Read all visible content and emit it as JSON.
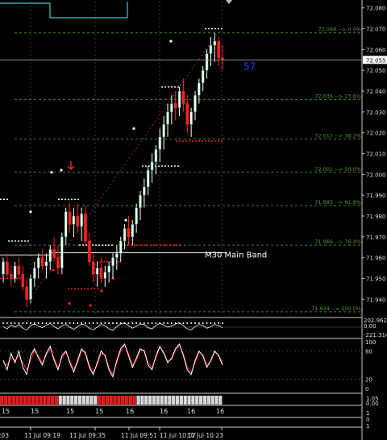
{
  "colors": {
    "background": "#000000",
    "grid": "#3a3a3a",
    "bull": "#ffffff",
    "bear": "#ff2020",
    "body_up": "#2e8b57",
    "fib": "#3f8a1f",
    "fib_text": "#4aa02c",
    "band": "#c8c8c8",
    "cyan_line": "#49c6cf",
    "price_label_bg": "#ffffff",
    "price_label_fg": "#000000",
    "counter": "#1a3cff",
    "stoch_white": "#ffffff",
    "stoch_red": "#ff2020",
    "axis_text": "#dddddd"
  },
  "window": {
    "top_marker_icon": "triangle-down-icon"
  },
  "price_axis": {
    "ticks": [
      "72.080",
      "72.070",
      "72.060",
      "72.050",
      "72.040",
      "72.030",
      "72.020",
      "72.010",
      "72.000",
      "71.990",
      "71.980",
      "71.970",
      "71.960",
      "71.950",
      "71.940"
    ],
    "current_price": "72.055",
    "bar_counter": "57"
  },
  "chart_data": {
    "type": "candlestick",
    "price_range": [
      71.932,
      72.083
    ],
    "fib_levels": [
      {
        "label": "72.068 --> 0.0%",
        "price": 72.068
      },
      {
        "label": "72.036 --> 23.6%",
        "price": 72.036
      },
      {
        "label": "72.017 --> 38.2%",
        "price": 72.017
      },
      {
        "label": "72.001 --> 50.0%",
        "price": 72.001
      },
      {
        "label": "71.985 --> 61.8%",
        "price": 71.985
      },
      {
        "label": "71.966 --> 76.4%",
        "price": 71.966
      },
      {
        "label": "71.934 --> 100.0%",
        "price": 71.934
      }
    ],
    "band_label": "M30 Main Band",
    "band_price": 71.962,
    "candles": [
      [
        71.952,
        71.96,
        71.948,
        71.958
      ],
      [
        71.958,
        71.962,
        71.95,
        71.952
      ],
      [
        71.952,
        71.956,
        71.946,
        71.95
      ],
      [
        71.95,
        71.958,
        71.948,
        71.956
      ],
      [
        71.956,
        71.96,
        71.95,
        71.952
      ],
      [
        71.952,
        71.956,
        71.944,
        71.946
      ],
      [
        71.946,
        71.95,
        71.936,
        71.94
      ],
      [
        71.94,
        71.952,
        71.938,
        71.95
      ],
      [
        71.95,
        71.958,
        71.946,
        71.955
      ],
      [
        71.955,
        71.962,
        71.95,
        71.96
      ],
      [
        71.96,
        71.964,
        71.954,
        71.956
      ],
      [
        71.956,
        71.962,
        71.95,
        71.958
      ],
      [
        71.958,
        71.966,
        71.954,
        71.964
      ],
      [
        71.964,
        71.97,
        71.958,
        71.96
      ],
      [
        71.96,
        71.966,
        71.952,
        71.955
      ],
      [
        71.955,
        71.972,
        71.952,
        71.97
      ],
      [
        71.97,
        71.984,
        71.966,
        71.982
      ],
      [
        71.982,
        71.986,
        71.972,
        71.976
      ],
      [
        71.976,
        71.984,
        71.97,
        71.98
      ],
      [
        71.98,
        71.986,
        71.972,
        71.975
      ],
      [
        71.975,
        71.984,
        71.968,
        71.981
      ],
      [
        71.981,
        71.985,
        71.966,
        71.968
      ],
      [
        71.968,
        71.972,
        71.956,
        71.958
      ],
      [
        71.958,
        71.962,
        71.948,
        71.952
      ],
      [
        71.952,
        71.958,
        71.946,
        71.955
      ],
      [
        71.955,
        71.96,
        71.948,
        71.95
      ],
      [
        71.95,
        71.956,
        71.946,
        71.953
      ],
      [
        71.953,
        71.958,
        71.948,
        71.956
      ],
      [
        71.956,
        71.962,
        71.95,
        71.96
      ],
      [
        71.96,
        71.966,
        71.954,
        71.962
      ],
      [
        71.962,
        71.97,
        71.958,
        71.968
      ],
      [
        71.968,
        71.976,
        71.964,
        71.974
      ],
      [
        71.974,
        71.98,
        71.966,
        71.97
      ],
      [
        71.97,
        71.978,
        71.966,
        71.976
      ],
      [
        71.976,
        71.986,
        71.972,
        71.984
      ],
      [
        71.984,
        71.992,
        71.978,
        71.99
      ],
      [
        71.99,
        71.998,
        71.984,
        71.994
      ],
      [
        71.994,
        72.004,
        71.99,
        72.002
      ],
      [
        72.002,
        72.01,
        71.996,
        72.006
      ],
      [
        72.006,
        72.014,
        72.0,
        72.012
      ],
      [
        72.012,
        72.022,
        72.006,
        72.018
      ],
      [
        72.018,
        72.028,
        72.012,
        72.024
      ],
      [
        72.024,
        72.034,
        72.018,
        72.03
      ],
      [
        72.03,
        72.038,
        72.024,
        72.034
      ],
      [
        72.034,
        72.04,
        72.026,
        72.032
      ],
      [
        72.032,
        72.042,
        72.028,
        72.04
      ],
      [
        72.04,
        72.046,
        72.03,
        72.034
      ],
      [
        72.034,
        72.038,
        72.02,
        72.024
      ],
      [
        72.024,
        72.032,
        72.018,
        72.03
      ],
      [
        72.03,
        72.04,
        72.026,
        72.038
      ],
      [
        72.038,
        72.046,
        72.034,
        72.044
      ],
      [
        72.044,
        72.052,
        72.04,
        72.05
      ],
      [
        72.05,
        72.06,
        72.046,
        72.058
      ],
      [
        72.058,
        72.066,
        72.052,
        72.062
      ],
      [
        72.062,
        72.068,
        72.054,
        72.064
      ],
      [
        72.064,
        72.066,
        72.052,
        72.056
      ],
      [
        72.056,
        72.062,
        72.05,
        72.055
      ]
    ],
    "stoch_main": [
      60,
      40,
      75,
      55,
      80,
      45,
      30,
      70,
      85,
      65,
      50,
      75,
      90,
      60,
      40,
      70,
      80,
      55,
      35,
      60,
      85,
      75,
      45,
      30,
      55,
      80,
      70,
      40,
      25,
      60,
      85,
      95,
      70,
      45,
      65,
      85,
      80,
      50,
      40,
      70,
      90,
      75,
      55,
      65,
      85,
      95,
      70,
      40,
      30,
      60,
      80,
      70,
      45,
      60,
      80,
      70,
      50
    ],
    "stoch_signal": [
      55,
      50,
      65,
      60,
      70,
      55,
      40,
      60,
      80,
      70,
      55,
      70,
      85,
      65,
      45,
      65,
      78,
      60,
      42,
      55,
      80,
      78,
      50,
      35,
      50,
      75,
      72,
      45,
      30,
      55,
      80,
      92,
      75,
      50,
      60,
      82,
      82,
      55,
      45,
      65,
      88,
      78,
      58,
      62,
      82,
      92,
      74,
      45,
      35,
      55,
      78,
      72,
      50,
      58,
      78,
      72,
      55
    ],
    "time_labels": [
      "11 Jul 09:03",
      "11 Jul 09:19",
      "11 Jul 09:35",
      "11 Jul 09:51",
      "11 Jul 10:07",
      "11 Jul 10:23"
    ],
    "period_labels": [
      "15",
      "15",
      "15",
      "15",
      "16",
      "16",
      "16",
      "16"
    ],
    "osc_labels": [
      "202.9624",
      "0.00",
      "-221.3141"
    ],
    "stoch_labels": [
      "100",
      "80",
      "20",
      "0"
    ],
    "hist_labels": [
      "1.05",
      "0.00"
    ],
    "bottom_labels": [
      "1",
      "0",
      "1"
    ],
    "heat_cells": [
      "red",
      "red",
      "red",
      "red",
      "red",
      "red",
      "red",
      "red",
      "red",
      "red",
      "red",
      "red",
      "red",
      "red",
      "red",
      "white",
      "white",
      "white",
      "white",
      "white",
      "white",
      "white",
      "white",
      "white",
      "white",
      "red",
      "red",
      "red",
      "red",
      "red",
      "red",
      "red",
      "red",
      "red",
      "red",
      "white",
      "white",
      "white",
      "white",
      "white",
      "white",
      "white",
      "white",
      "white",
      "white",
      "white",
      "white",
      "white",
      "white",
      "white",
      "white",
      "white",
      "white",
      "white",
      "white",
      "white",
      "white"
    ]
  }
}
